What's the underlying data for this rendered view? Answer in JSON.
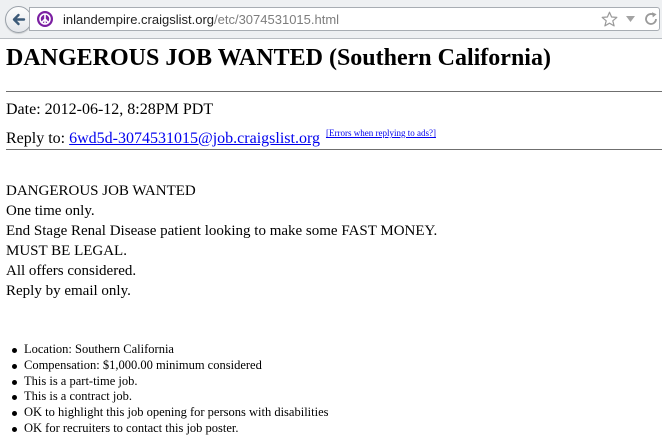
{
  "browser": {
    "url_prefix": "",
    "url_domain": "inlandempire.craigslist.org",
    "url_path": "/etc/3074531015.html"
  },
  "posting": {
    "title": "DANGEROUS JOB WANTED (Southern California)",
    "date_label": "Date: 2012-06-12, 8:28PM PDT",
    "reply_prefix": "Reply to: ",
    "reply_email": "6wd5d-3074531015@job.craigslist.org",
    "errors_link": "[Errors when replying to ads?]",
    "body": [
      "DANGEROUS JOB WANTED",
      "One time only.",
      "End Stage Renal Disease patient looking to make some FAST MONEY.",
      "MUST BE LEGAL.",
      "All offers considered.",
      "Reply by email only."
    ],
    "details": [
      "Location: Southern California",
      "Compensation: $1,000.00 minimum considered",
      "This is a part-time job.",
      "This is a contract job.",
      "OK to highlight this job opening for persons with disabilities",
      "OK for recruiters to contact this job poster."
    ]
  },
  "colors": {
    "link": "#0000ee",
    "favicon": "#7b1fa2"
  },
  "icons": {
    "back": "back-arrow-icon",
    "site": "peace-sign-icon",
    "bookmark": "star-icon",
    "history": "chevron-down-icon",
    "reload": "reload-icon"
  }
}
